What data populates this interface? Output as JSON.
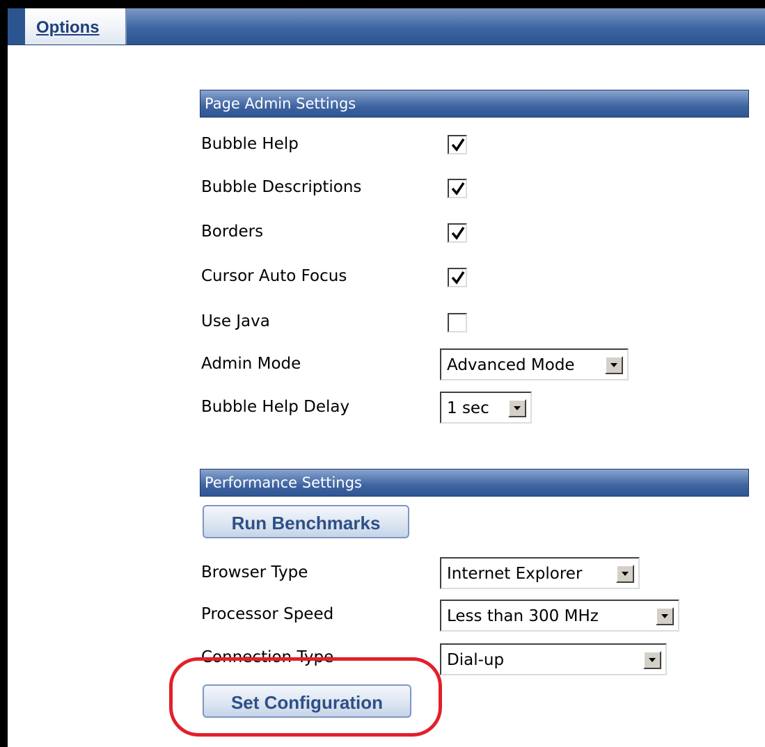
{
  "tab": {
    "label": "Options"
  },
  "page_admin": {
    "title": "Page Admin Settings",
    "checkboxes": [
      {
        "label": "Bubble Help",
        "checked": true
      },
      {
        "label": "Bubble Descriptions",
        "checked": true
      },
      {
        "label": "Borders",
        "checked": true
      },
      {
        "label": "Cursor Auto Focus",
        "checked": true
      },
      {
        "label": "Use Java",
        "checked": false
      }
    ],
    "admin_mode": {
      "label": "Admin Mode",
      "value": "Advanced Mode"
    },
    "bubble_help_delay": {
      "label": "Bubble Help Delay",
      "value": "1 sec"
    }
  },
  "performance": {
    "title": "Performance Settings",
    "run_benchmarks_label": "Run Benchmarks",
    "browser_type": {
      "label": "Browser Type",
      "value": "Internet Explorer"
    },
    "processor_speed": {
      "label": "Processor Speed",
      "value": "Less than 300 MHz"
    },
    "connection_type": {
      "label": "Connection Type",
      "value": "Dial-up"
    },
    "set_configuration_label": "Set Configuration"
  },
  "colors": {
    "header_blue": "#3e64a2",
    "button_text": "#2e4f86",
    "highlight_red": "#e2202a"
  }
}
